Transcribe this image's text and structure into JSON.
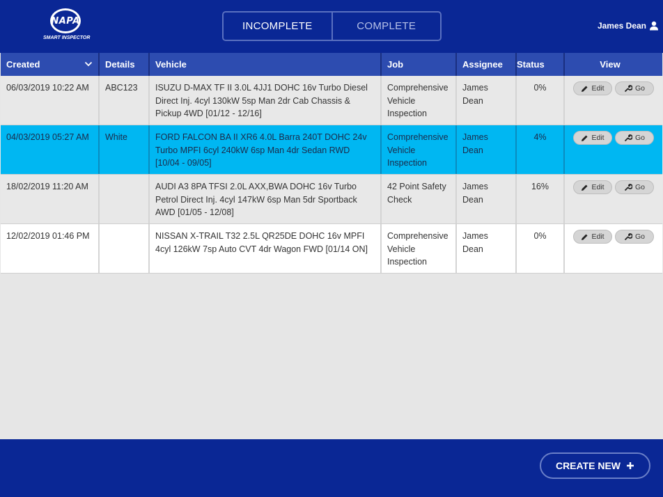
{
  "header": {
    "logo_text": "NAPA",
    "logo_subtitle": "SMART INSPECTOR",
    "tabs": [
      {
        "label": "INCOMPLETE",
        "active": true
      },
      {
        "label": "COMPLETE",
        "active": false
      }
    ],
    "user_name": "James Dean"
  },
  "table": {
    "columns": [
      "Created",
      "Details",
      "Vehicle",
      "Job",
      "Assignee",
      "Status",
      "View"
    ],
    "rows": [
      {
        "created": "06/03/2019 10:22 AM",
        "details": "ABC123",
        "vehicle": "ISUZU D-MAX TF II 3.0L 4JJ1 DOHC 16v Turbo Diesel Direct Inj. 4cyl 130kW 5sp Man 2dr Cab Chassis & Pickup 4WD [01/12 - 12/16]",
        "job": "Comprehensive Vehicle Inspection",
        "assignee": "James Dean",
        "status": "0%",
        "edit_label": "Edit",
        "go_label": "Go"
      },
      {
        "created": "04/03/2019 05:27 AM",
        "details": "White",
        "vehicle": "FORD FALCON BA II XR6 4.0L Barra 240T DOHC 24v Turbo MPFI 6cyl 240kW 6sp Man 4dr Sedan RWD [10/04 - 09/05]",
        "job": "Comprehensive Vehicle Inspection",
        "assignee": "James Dean",
        "status": "4%",
        "edit_label": "Edit",
        "go_label": "Go"
      },
      {
        "created": "18/02/2019 11:20 AM",
        "details": "",
        "vehicle": "AUDI A3 8PA TFSI 2.0L AXX,BWA DOHC 16v Turbo Petrol Direct Inj. 4cyl 147kW 6sp Man 5dr Sportback AWD [01/05 - 12/08]",
        "job": "42 Point Safety Check",
        "assignee": "James Dean",
        "status": "16%",
        "edit_label": "Edit",
        "go_label": "Go"
      },
      {
        "created": "12/02/2019 01:46 PM",
        "details": "",
        "vehicle": "NISSAN X-TRAIL T32 2.5L QR25DE DOHC 16v MPFI 4cyl 126kW 7sp Auto CVT 4dr Wagon FWD [01/14 ON]",
        "job": "Comprehensive Vehicle Inspection",
        "assignee": "James Dean",
        "status": "0%",
        "edit_label": "Edit",
        "go_label": "Go"
      }
    ]
  },
  "footer": {
    "create_label": "CREATE NEW"
  },
  "colors": {
    "brand_blue": "#0a2795",
    "header_row": "#2d4cb0",
    "selected_row": "#00b7f2",
    "background": "#e6e6e6"
  },
  "icons": [
    "user-icon",
    "chevron-down-icon",
    "pencil-icon",
    "wrench-icon",
    "plus-icon"
  ]
}
